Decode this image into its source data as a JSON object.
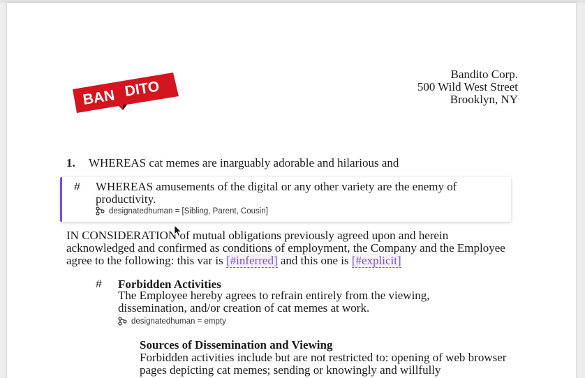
{
  "company": {
    "logo_text_left": "BAN",
    "logo_text_right": "DITO",
    "name": "Bandito Corp.",
    "street": "500 Wild West Street",
    "city": "Brooklyn, NY"
  },
  "clauses": [
    {
      "number": "1.",
      "text": "WHEREAS cat memes are inarguably adorable and hilarious and"
    },
    {
      "number": "#",
      "text": "WHEREAS amusements of the digital or any other variety are the enemy of productivity.",
      "variable": "designatedhuman = [Sibling, Parent, Cousin]"
    }
  ],
  "consideration": {
    "text_before": "IN CONSIDERATION of mutual obligations previously agreed upon and herein acknowledged and confirmed as conditions of employment, the Company and the Employee agree to the following: this var is ",
    "tag1": "[#inferred]",
    "text_middle": " and this one is ",
    "tag2": "[#explicit]"
  },
  "section": {
    "number": "#",
    "heading": "Forbidden Activities",
    "body": "The Employee hereby agrees to refrain entirely from the viewing, dissemination, and/or creation of cat memes at work.",
    "variable": "designatedhuman = empty"
  },
  "subsection": {
    "heading": "Sources of Dissemination and Viewing",
    "body": "Forbidden activities include but are not restricted to: opening of web browser pages depicting cat memes; sending or knowingly and willfully"
  },
  "colors": {
    "accent": "#7a4fd6",
    "logo_red": "#d4151f"
  },
  "icons": {
    "variable": "branch-icon",
    "pointer": "cursor-icon"
  }
}
